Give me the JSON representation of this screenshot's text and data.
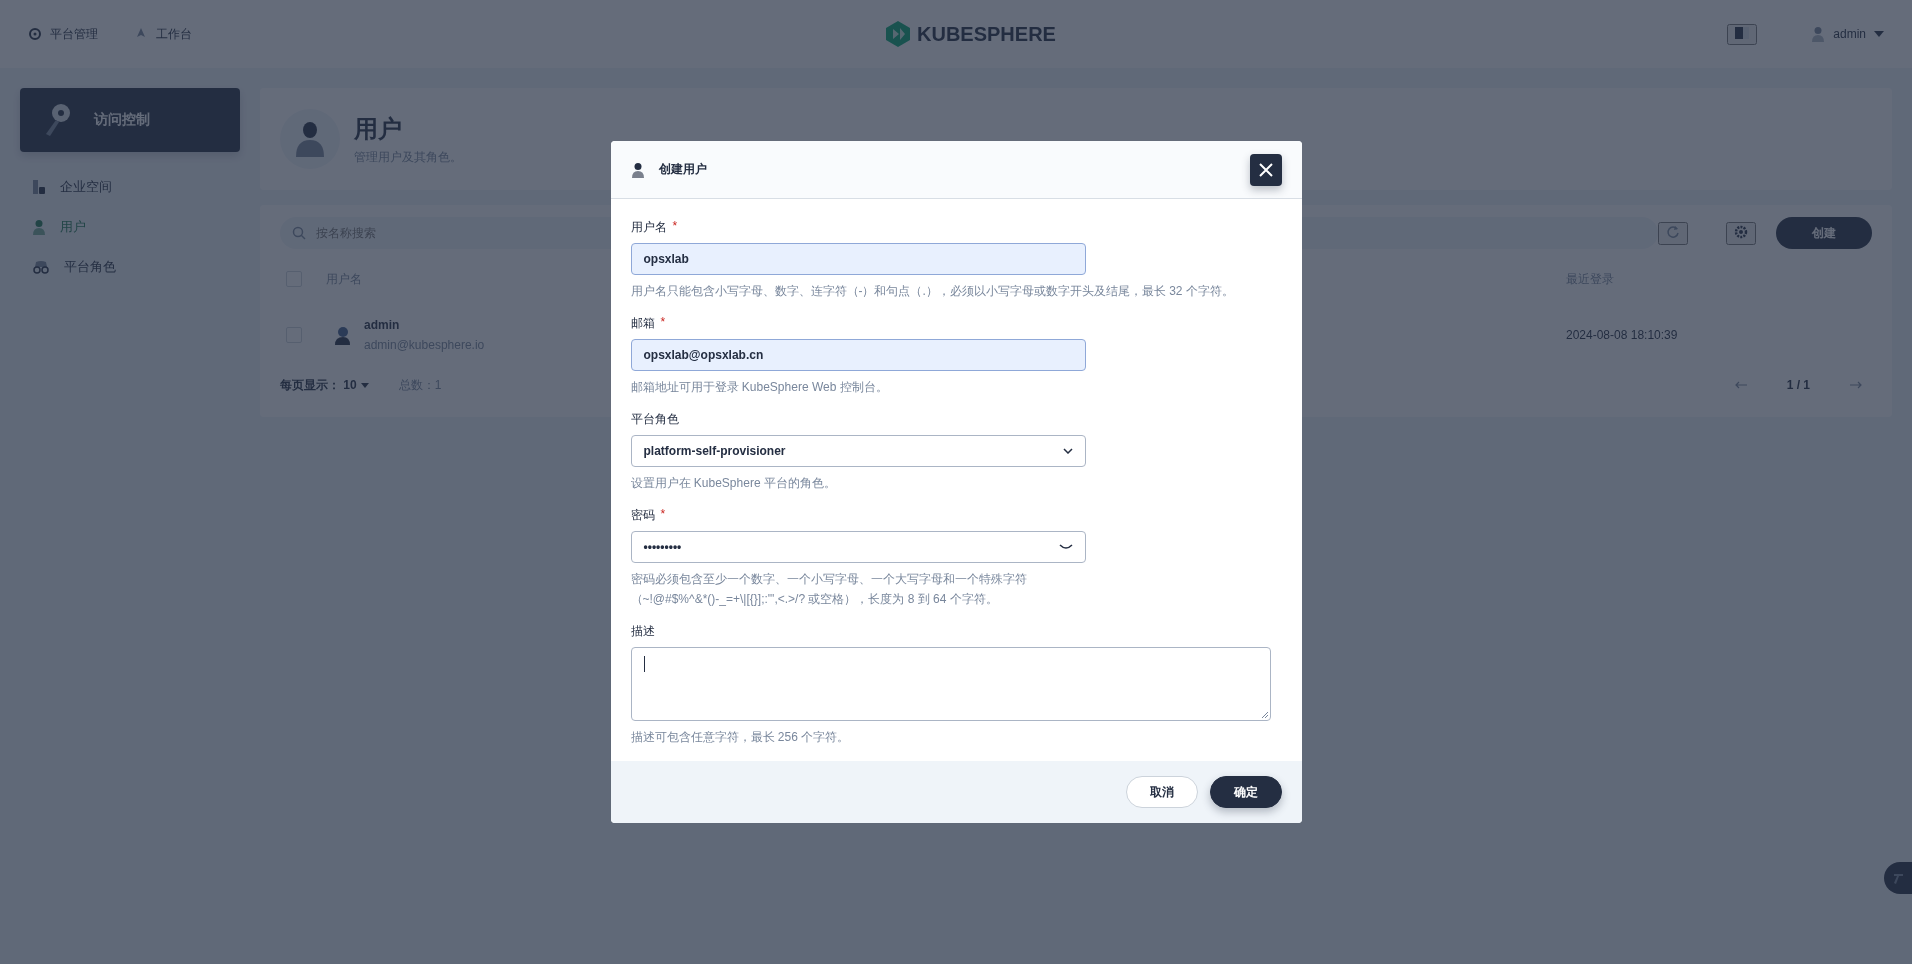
{
  "top_bar": {
    "nav": [
      {
        "label": "平台管理",
        "kind": "gear"
      },
      {
        "label": "工作台",
        "kind": "bench"
      }
    ],
    "logo": "KUBESPHERE",
    "user": "admin"
  },
  "sidebar": {
    "title": "访问控制",
    "items": [
      {
        "label": "企业空间",
        "kind": "workspace",
        "selected": false
      },
      {
        "label": "用户",
        "kind": "user",
        "selected": true
      },
      {
        "label": "平台角色",
        "kind": "role",
        "selected": false
      }
    ]
  },
  "page_header": {
    "title": "用户",
    "subtitle": "管理用户及其角色。"
  },
  "toolbar": {
    "search_placeholder": "按名称搜索",
    "create_button": "创建"
  },
  "table": {
    "select_all_checked": false,
    "columns": [
      {
        "label": "用户名"
      },
      {
        "label": "最近登录"
      }
    ],
    "rows": [
      {
        "name": "admin",
        "email": "admin@kubesphere.io",
        "last_login": "2024-08-08 18:10:39",
        "checked": false
      }
    ]
  },
  "pagination": {
    "page_size_label": "每页显示：",
    "page_size": "10",
    "total": "总数：1",
    "page": "1 / 1"
  },
  "dialog": {
    "title": "创建用户",
    "fields": [
      {
        "kind": "text",
        "label": "用户名",
        "required_mark": "*",
        "value": "opsxlab",
        "autofilled": true,
        "hint": "用户名只能包含小写字母、数字、连字符（-）和句点（.），必须以小写字母或数字开头及结尾，最长 32 个字符。"
      },
      {
        "kind": "text",
        "label": "邮箱",
        "required_mark": "*",
        "value": "opsxlab@opsxlab.cn",
        "autofilled": true,
        "hint": "邮箱地址可用于登录 KubeSphere Web 控制台。"
      },
      {
        "kind": "select",
        "label": "平台角色",
        "value": "platform-self-provisioner",
        "autofilled": false,
        "hint": "设置用户在 KubeSphere 平台的角色。"
      },
      {
        "kind": "password",
        "label": "密码",
        "required_mark": "*",
        "value": "•••••••••",
        "autofilled": false,
        "hint": "密码必须包含至少一个数字、一个小写字母、一个大写字母和一个特殊字符（~!@#$%^&*()-_=+\\|[{}];:'\",<.>/? 或空格），长度为 8 到 64 个字符。"
      },
      {
        "kind": "textarea",
        "label": "描述",
        "autofilled": false,
        "hint": "描述可包含任意字符，最长 256 个字符。"
      }
    ],
    "buttons": [
      {
        "label": "取消",
        "primary": false
      },
      {
        "label": "确定",
        "primary": true
      }
    ]
  }
}
